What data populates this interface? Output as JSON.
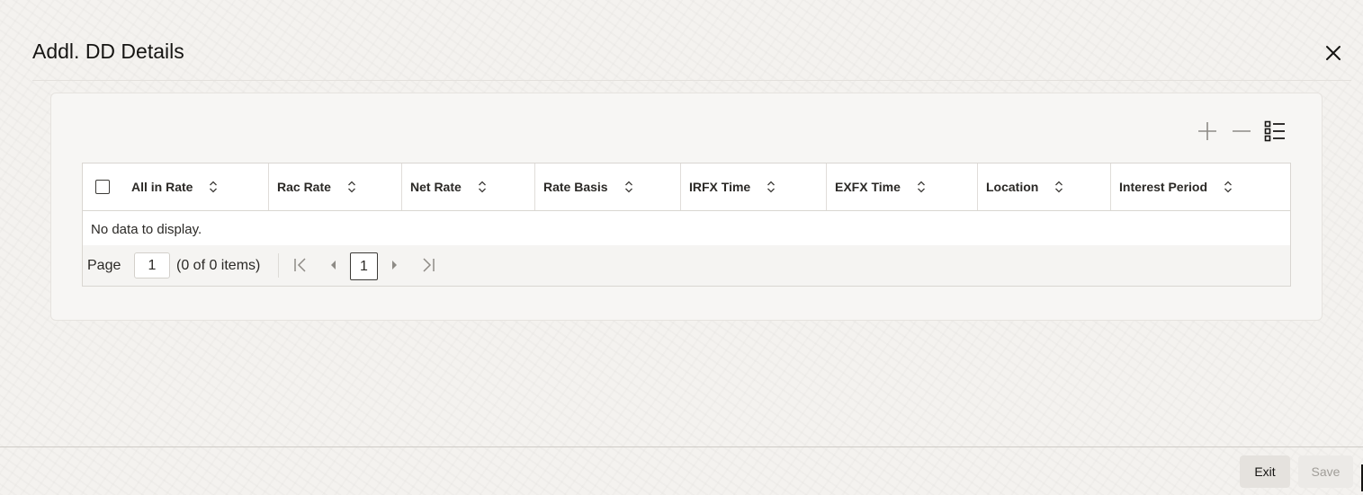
{
  "dialog": {
    "title": "Addl. DD Details",
    "close_icon": "close-icon"
  },
  "toolbar": {
    "add_icon": "plus-icon",
    "remove_icon": "minus-icon",
    "columns_icon": "list-settings-icon"
  },
  "table": {
    "columns": [
      "All in Rate",
      "Rac Rate",
      "Net Rate",
      "Rate Basis",
      "IRFX Time",
      "EXFX Time",
      "Location",
      "Interest Period"
    ],
    "empty_message": "No data to display.",
    "rows": []
  },
  "pagination": {
    "page_label": "Page",
    "page_value": "1",
    "count_text": "(0 of 0 items)",
    "current_page": "1"
  },
  "footer": {
    "exit_label": "Exit",
    "save_label": "Save"
  },
  "colors": {
    "accent": "#161513",
    "background": "#f4f2ef",
    "disabled_text": "#a19e99"
  }
}
